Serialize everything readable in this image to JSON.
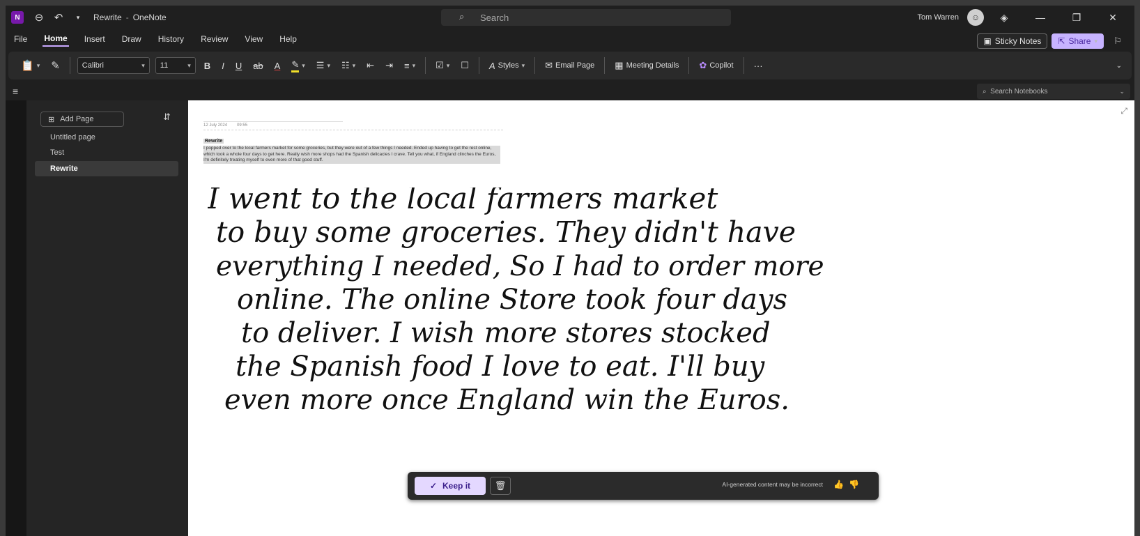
{
  "titlebar": {
    "doc_title": "Rewrite",
    "app_name": "OneNote",
    "search_placeholder": "Search",
    "user_name": "Tom Warren"
  },
  "menu": {
    "items": [
      "File",
      "Home",
      "Insert",
      "Draw",
      "History",
      "Review",
      "View",
      "Help"
    ],
    "active": "Home",
    "sticky_notes": "Sticky Notes",
    "share": "Share"
  },
  "ribbon": {
    "font_name": "Calibri",
    "font_size": "11",
    "bold": "B",
    "italic": "I",
    "underline": "U",
    "strike": "ab",
    "font_color": "A",
    "styles": "Styles",
    "email_page": "Email Page",
    "meeting_details": "Meeting Details",
    "copilot": "Copilot",
    "more": "···"
  },
  "subbar": {
    "notebook_search": "Search Notebooks"
  },
  "pages": {
    "add_page": "Add Page",
    "items": [
      "Untitled page",
      "Test",
      "Rewrite"
    ],
    "selected": "Rewrite"
  },
  "note": {
    "date": "12 July 2024",
    "time": "09:55",
    "title": "Rewrite",
    "body": "I popped over to the local farmers market for some groceries, but they were out of a few things I needed. Ended up having to get the rest online, which took a whole four days to get here. Really wish more shops had the Spanish delicacies I crave. Tell you what, if England clinches the Euros, I'm definitely treating myself to even more of that good stuff.",
    "handwriting": [
      "I went to the local farmers market",
      "to buy some groceries. They didn't have",
      "everything I needed, So I had to order more",
      "online. The online Store took four days",
      "to deliver. I wish more stores stocked",
      "the Spanish food I love to eat. I'll buy",
      "even more once England win the Euros."
    ]
  },
  "ai_bar": {
    "keep_label": "Keep it",
    "disclaimer": "AI-generated content may be incorrect"
  },
  "colors": {
    "accent": "#c7b3ff",
    "onenote": "#7719aa",
    "canvas": "#ffffff",
    "chrome": "#1f1f1f"
  }
}
